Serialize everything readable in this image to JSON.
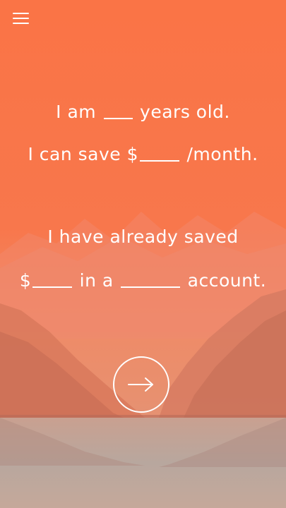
{
  "colors": {
    "accent": "#f9754a",
    "text": "#ffffff"
  },
  "header": {
    "menu_icon": "hamburger-menu-icon"
  },
  "form": {
    "age": {
      "prefix": "I am",
      "value": "",
      "suffix": "years old."
    },
    "monthly_savings": {
      "prefix": "I can save $",
      "value": "",
      "suffix": "/month."
    },
    "already_saved_intro": "I have already saved",
    "saved": {
      "prefix": "$",
      "value": "",
      "middle": "in a",
      "account_type": "",
      "suffix": "account."
    }
  },
  "navigation": {
    "next_icon": "arrow-right-icon"
  }
}
